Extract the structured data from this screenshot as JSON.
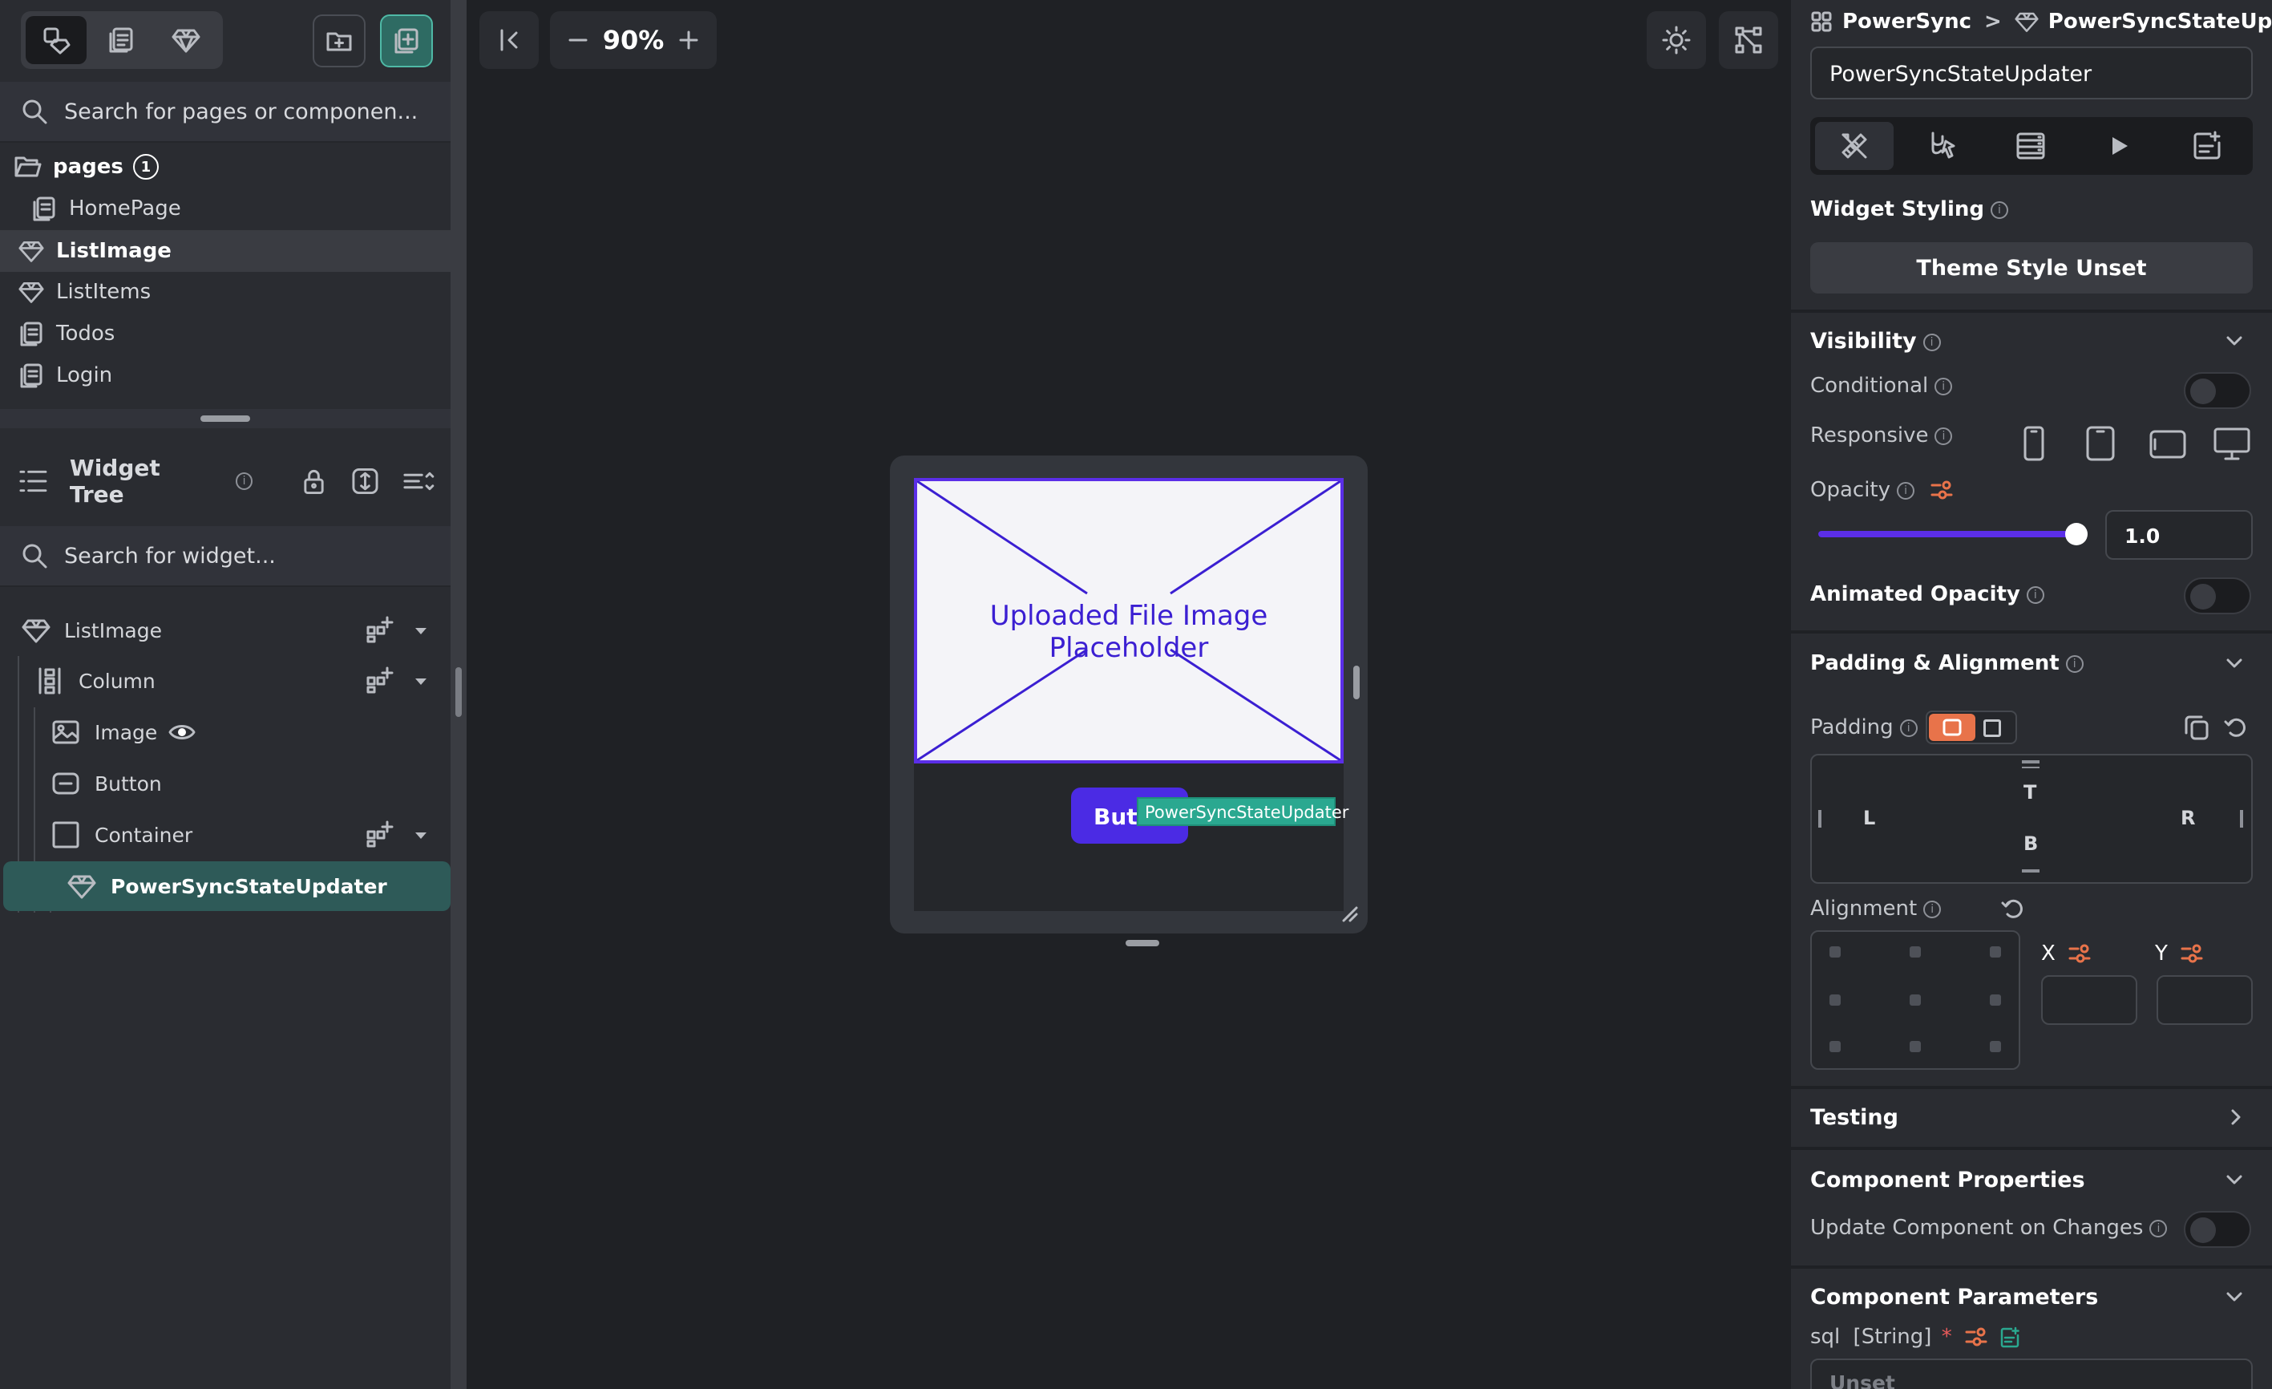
{
  "left_panel": {
    "page_search": {
      "placeholder": "Search for pages or componen..."
    },
    "pages": {
      "label": "pages",
      "count": "1",
      "items": [
        "HomePage",
        "ListImage",
        "ListItems",
        "Todos",
        "Login"
      ]
    },
    "widget_tree": {
      "title": "Widget Tree",
      "search_placeholder": "Search for widget...",
      "nodes": [
        "ListImage",
        "Column",
        "Image",
        "Button",
        "Container",
        "PowerSyncStateUpdater"
      ]
    }
  },
  "canvas": {
    "zoom": "90%",
    "image_placeholder_label": "Uploaded File Image Placeholder",
    "button_label": "Button",
    "selected_tag": "PowerSyncStateUpdater"
  },
  "right_panel": {
    "breadcrumb": {
      "project": "PowerSync",
      "separator": ">",
      "component": "PowerSyncStateUpdater"
    },
    "name_value": "PowerSyncStateUpdater",
    "widget_styling": {
      "title": "Widget Styling",
      "theme_button": "Theme Style Unset"
    },
    "visibility": {
      "title": "Visibility",
      "conditional": "Conditional",
      "responsive": "Responsive",
      "opacity": "Opacity",
      "opacity_value": "1.0",
      "opacity_level": 1.0,
      "animated_opacity": "Animated Opacity"
    },
    "padding_alignment": {
      "title": "Padding & Alignment",
      "padding": "Padding",
      "top": "T",
      "left": "L",
      "right": "R",
      "bottom": "B",
      "alignment": "Alignment",
      "x": "X",
      "y": "Y"
    },
    "testing": {
      "title": "Testing"
    },
    "component_properties": {
      "title": "Component Properties",
      "update_on_changes": "Update Component on Changes"
    },
    "component_parameters": {
      "title": "Component Parameters",
      "param_name": "sql",
      "param_type": "[String]",
      "required_mark": "*",
      "param_value": "Unset"
    }
  },
  "colors": {
    "accent": "#5b2ee8",
    "teal": "#2aa890",
    "selected_row": "#2e5a58",
    "orange": "#e8734a"
  }
}
